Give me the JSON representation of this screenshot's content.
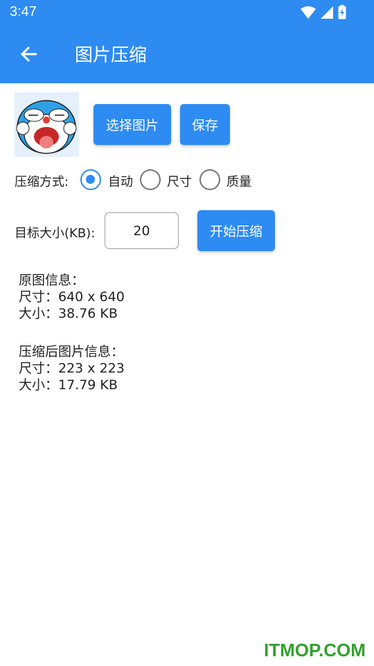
{
  "status_bar": {
    "time": "3:47"
  },
  "app_bar": {
    "title": "图片压缩"
  },
  "actions": {
    "select_label": "选择图片",
    "save_label": "保存"
  },
  "compress_mode": {
    "label": "压缩方式:",
    "options": [
      "自动",
      "尺寸",
      "质量"
    ],
    "selected": "自动"
  },
  "target": {
    "label": "目标大小(KB):",
    "value": "20",
    "start_label": "开始压缩"
  },
  "original_info": {
    "heading": "原图信息：",
    "size_line": "尺寸：640 x 640",
    "filesize_line": "大小：38.76 KB"
  },
  "compressed_info": {
    "heading": "压缩后图片信息：",
    "size_line": "尺寸：223 x 223",
    "filesize_line": "大小：17.79 KB"
  },
  "watermark": "ITMOP.COM",
  "colors": {
    "primary": "#2e8bf2",
    "watermark": "#33a12e"
  }
}
